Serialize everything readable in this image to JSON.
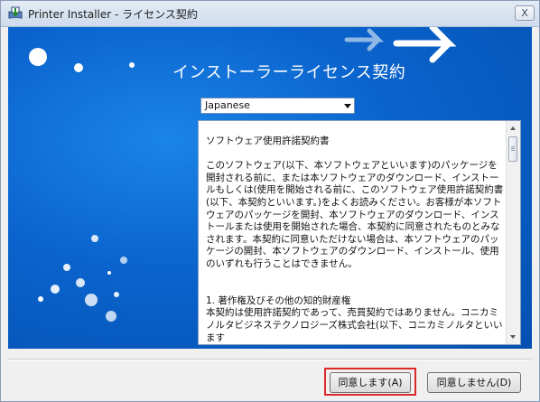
{
  "window": {
    "title": "Printer Installer - ライセンス契約",
    "close_label": "X"
  },
  "banner": {
    "title": "インストーラーライセンス契約"
  },
  "language_select": {
    "selected": "Japanese"
  },
  "license": {
    "heading": "ソフトウェア使用許諾契約書",
    "paragraph": "このソフトウェア(以下、本ソフトウェアといいます)のパッケージを開封される前に、または本ソフトウェアのダウンロード、インストールもしくは(使用を開始される前に、このソフトウェア使用許諾契約書(以下、本契約といいます。)をよくお読みください。お客様が本ソフトウェアのパッケージを開封、本ソフトウェアのダウンロード、インストールまたは使用を開始された場合、本契約に同意されたものとみなされます。本契約に同意いただけない場合は、本ソフトウェアのパッケージの開封、本ソフトウェアのダウンロード、インストール、使用のいずれも行うことはできません。",
    "section_title": "1. 著作権及びその他の知的財産権",
    "section_text": "本契約は使用許諾契約であって、売買契約ではありません。コニカミノルタビジネステクノロジーズ株式会社(以下、コニカミノルタといいます"
  },
  "buttons": {
    "agree": "同意します(A)",
    "disagree": "同意しません(D)"
  }
}
